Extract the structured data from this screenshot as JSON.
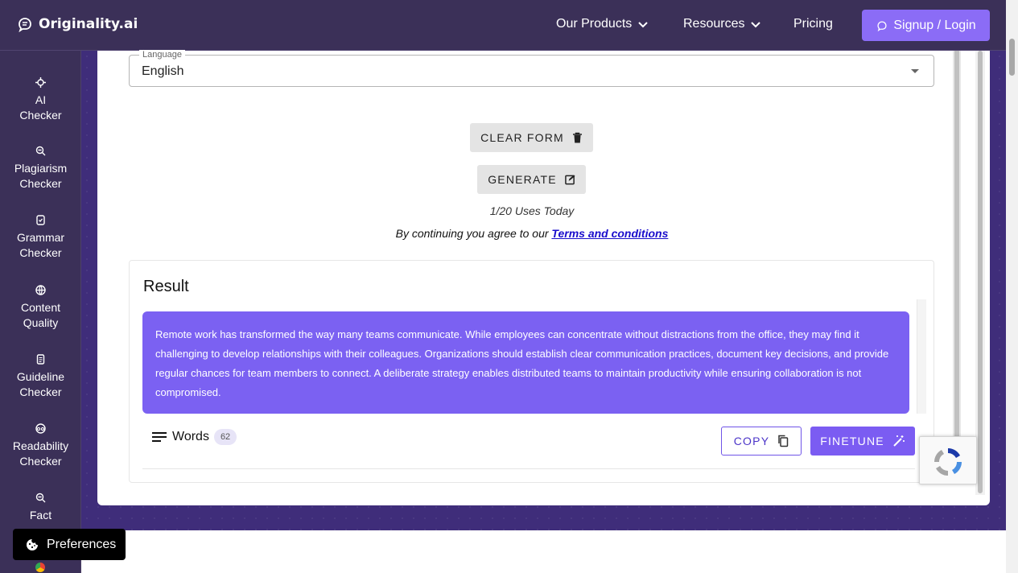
{
  "nav": {
    "brand": "Originality.ai",
    "links": [
      {
        "label": "Our Products",
        "has_dropdown": true
      },
      {
        "label": "Resources",
        "has_dropdown": true
      },
      {
        "label": "Pricing",
        "has_dropdown": false
      }
    ],
    "signup_label": "Signup / Login"
  },
  "sidebar": {
    "items": [
      {
        "line1": "AI",
        "line2": "Checker",
        "icon": "ai-checker-icon"
      },
      {
        "line1": "Plagiarism",
        "line2": "Checker",
        "icon": "search-icon"
      },
      {
        "line1": "Grammar",
        "line2": "Checker",
        "icon": "grammar-icon"
      },
      {
        "line1": "Content",
        "line2": "Quality",
        "icon": "globe-icon"
      },
      {
        "line1": "Guideline",
        "line2": "Checker",
        "icon": "document-icon"
      },
      {
        "line1": "Readability",
        "line2": "Checker",
        "icon": "readability-icon"
      },
      {
        "line1": "Fact",
        "line2": "",
        "icon": "search-icon"
      }
    ]
  },
  "form": {
    "language_legend": "Language",
    "language_value": "English",
    "clear_label": "CLEAR FORM",
    "generate_label": "GENERATE",
    "uses_text": "1/20 Uses Today",
    "terms_prefix": "By continuing you agree to our ",
    "terms_link": "Terms and conditions"
  },
  "result": {
    "title": "Result",
    "text": "Remote work has transformed the way many teams communicate. While employees can concentrate without distractions from the office, they may find it challenging to develop relationships with their colleagues. Organizations should establish clear communication practices, document key decisions, and provide regular chances for team members to connect. A deliberate strategy enables distributed teams to maintain productivity while ensuring collaboration is not compromised.",
    "words_label": "Words",
    "word_count": "62",
    "copy_label": "COPY",
    "finetune_label": "FINETUNE"
  },
  "preferences_label": "Preferences",
  "colors": {
    "nav_bg": "#3b3058",
    "accent": "#7b5cf2",
    "result_bg": "#7b61f2",
    "signup_bg": "#8b6cf6"
  }
}
